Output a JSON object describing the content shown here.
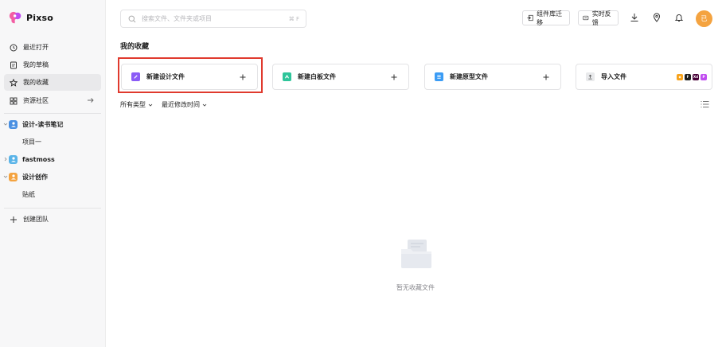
{
  "app": {
    "name": "Pixso",
    "brand_color": "#c04cf0"
  },
  "sidebar": {
    "nav": [
      {
        "label": "最近打开",
        "icon": "clock-icon"
      },
      {
        "label": "我的草稿",
        "icon": "file-icon"
      },
      {
        "label": "我的收藏",
        "icon": "star-icon"
      },
      {
        "label": "资源社区",
        "icon": "grid-icon"
      }
    ],
    "teams": [
      {
        "label": "设计-读书笔记",
        "color": "#4a90e2",
        "children": [
          "项目一"
        ]
      },
      {
        "label": "fastmoss",
        "color": "#5ab4e8",
        "children": []
      },
      {
        "label": "设计创作",
        "color": "#f4a340",
        "children": [
          "贴纸"
        ]
      }
    ],
    "create_team": "创建团队"
  },
  "search": {
    "placeholder": "搜索文件、文件夹或项目",
    "shortcut": "⌘ F"
  },
  "top_actions": {
    "migrate_label": "组件库迁移",
    "feedback_label": "实时反馈",
    "avatar_text": "已"
  },
  "main": {
    "title": "我的收藏",
    "cards": [
      {
        "label": "新建设计文件",
        "color": "#8b5cf6"
      },
      {
        "label": "新建白板文件",
        "color": "#2ec59a"
      },
      {
        "label": "新建原型文件",
        "color": "#3b9cf5"
      },
      {
        "label": "导入文件",
        "color": "#9aa0a6"
      }
    ],
    "filter_type": "所有类型",
    "filter_sort": "最近修改时间",
    "empty_text": "暂无收藏文件"
  }
}
